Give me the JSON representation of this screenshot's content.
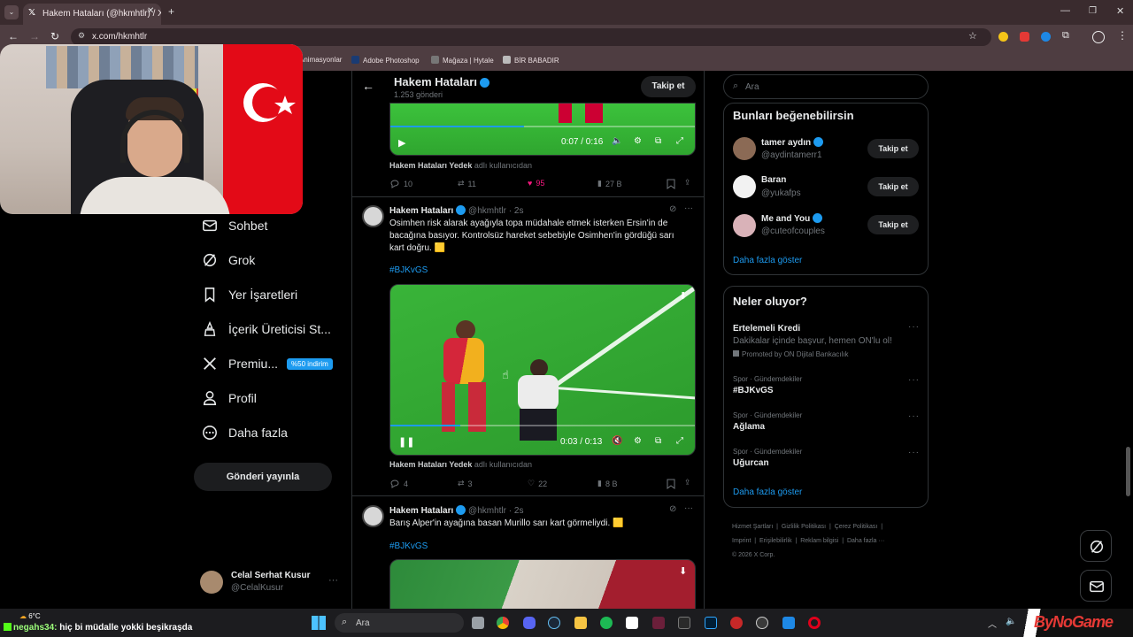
{
  "browser": {
    "tab_title": "Hakem Hataları (@hkmhtlr) / X",
    "url": "x.com/hkmhtlr",
    "bookmarks": [
      "Animasyonlar",
      "Adobe Photoshop",
      "Mağaza | Hytale",
      "BİR BABADIR"
    ]
  },
  "nav": {
    "items": [
      {
        "label": "Sohbet",
        "icon": "mail-icon"
      },
      {
        "label": "Grok",
        "icon": "grok-icon"
      },
      {
        "label": "Yer İşaretleri",
        "icon": "bookmark-icon"
      },
      {
        "label": "İçerik Üreticisi St...",
        "icon": "creator-icon"
      },
      {
        "label": "Premiu...",
        "icon": "x-logo-icon"
      },
      {
        "label": "Profil",
        "icon": "person-icon"
      },
      {
        "label": "Daha fazla",
        "icon": "more-circle-icon"
      }
    ],
    "premium_badge": "%50 indirim",
    "post_button": "Gönderi yayınla",
    "account": {
      "name": "Celal Serhat Kusur",
      "handle": "@CelalKusur"
    }
  },
  "header": {
    "title": "Hakem Hataları",
    "post_count": "1.253 gönderi",
    "follow_label": "Takip et"
  },
  "tweets": [
    {
      "video_time": "0:07 / 0:16",
      "attribution_user": "Hakem Hataları Yedek",
      "attribution_suffix": "adlı kullanıcıdan",
      "replies": "10",
      "reposts": "11",
      "likes": "95",
      "views": "27 B"
    },
    {
      "author": "Hakem Hataları",
      "handle": "@hkmhtlr",
      "time": "2s",
      "text": "Osimhen risk alarak ayağıyla topa müdahale etmek isterken Ersin'in de bacağına basıyor. Kontrolsüz hareket sebebiyle Osimhen'in gördüğü sarı kart doğru. 🟨",
      "hashtag": "#BJKvGS",
      "video_time": "0:03 / 0:13",
      "attribution_user": "Hakem Hataları Yedek",
      "attribution_suffix": "adlı kullanıcıdan",
      "replies": "4",
      "reposts": "3",
      "likes": "22",
      "views": "8 B"
    },
    {
      "author": "Hakem Hataları",
      "handle": "@hkmhtlr",
      "time": "2s",
      "text": "Barış Alper'in ayağına basan Murillo sarı kart görmeliydi. 🟨",
      "hashtag": "#BJKvGS"
    }
  ],
  "search": {
    "placeholder": "Ara"
  },
  "who_to_follow": {
    "title": "Bunları beğenebilirsin",
    "users": [
      {
        "name": "tamer aydın",
        "handle": "@aydintamerr1",
        "button": "Takip et"
      },
      {
        "name": "Baran",
        "handle": "@yukafps",
        "button": "Takip et"
      },
      {
        "name": "Me and You",
        "handle": "@cuteofcouples",
        "button": "Takip et"
      }
    ],
    "show_more": "Daha fazla göster"
  },
  "trends": {
    "title": "Neler oluyor?",
    "promoted": {
      "name": "Ertelemeli Kredi",
      "desc": "Dakikalar içinde başvur, hemen ON'lu ol!",
      "promoted_by": "Promoted by ON Dijital Bankacılık"
    },
    "items": [
      {
        "category": "Spor · Gündemdekiler",
        "name": "#BJKvGS"
      },
      {
        "category": "Spor · Gündemdekiler",
        "name": "Ağlama"
      },
      {
        "category": "Spor · Gündemdekiler",
        "name": "Uğurcan"
      }
    ],
    "show_more": "Daha fazla göster"
  },
  "footer": {
    "links": [
      "Hizmet Şartları",
      "Gizlilik Politikası",
      "Çerez Politikası",
      "Imprint",
      "Erişilebilirlik",
      "Reklam bilgisi",
      "Daha fazla ···"
    ],
    "copyright": "© 2026 X Corp."
  },
  "overlay": {
    "chat_user": "negahs34:",
    "chat_msg": "hiç bi müdalle yokki beşikraşda",
    "weather": "6°C",
    "brand": "ByNoGame"
  },
  "taskbar": {
    "search_placeholder": "Ara"
  },
  "colors": {
    "accent": "#1d9bf0",
    "like_active": "#f91880",
    "browser_frame": "#4e3d41"
  }
}
